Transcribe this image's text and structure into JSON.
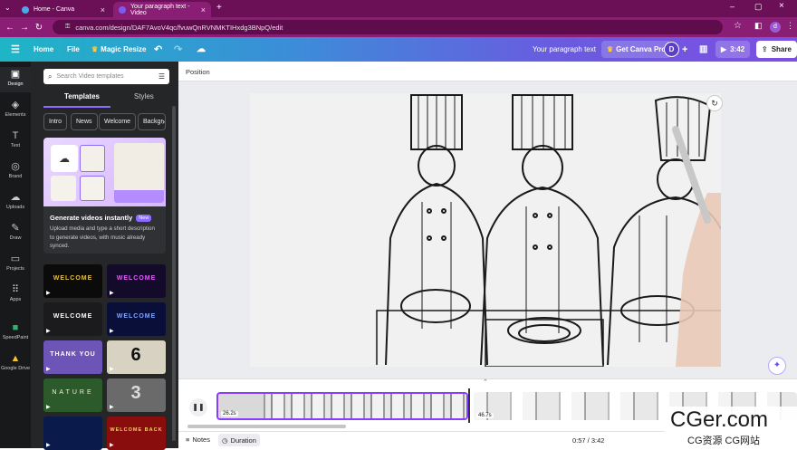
{
  "browser": {
    "tabs": [
      {
        "title": "Home - Canva",
        "active": false
      },
      {
        "title": "Your paragraph text - Video",
        "active": true
      }
    ],
    "new_tab": "+",
    "url": "canva.com/design/DAF7AvoV4qc/fvuwQnRVNMKTIHxdg3BNpQ/edit"
  },
  "topbar": {
    "menu_icon": "☰",
    "home": "Home",
    "file": "File",
    "magic_resize": "Magic Resize",
    "doc_title": "Your paragraph text",
    "get_pro": "Get Canva Pro",
    "avatar": "D",
    "plus": "+",
    "play_time": "3:42",
    "share": "Share"
  },
  "rail": [
    {
      "label": "Design",
      "icon": "▣"
    },
    {
      "label": "Elements",
      "icon": "◈"
    },
    {
      "label": "Text",
      "icon": "T"
    },
    {
      "label": "Brand",
      "icon": "◎"
    },
    {
      "label": "Uploads",
      "icon": "☁"
    },
    {
      "label": "Draw",
      "icon": "✎"
    },
    {
      "label": "Projects",
      "icon": "▭"
    },
    {
      "label": "Apps",
      "icon": "⠿"
    },
    {
      "label": "SpeedPaint",
      "icon": "■"
    },
    {
      "label": "Google Drive",
      "icon": "▲"
    }
  ],
  "panel": {
    "search_placeholder": "Search Video templates",
    "tabs": [
      "Templates",
      "Styles"
    ],
    "chips": [
      "Intro",
      "News",
      "Welcome",
      "Backgr"
    ],
    "promo": {
      "title": "Generate videos instantly",
      "badge": "New",
      "text": "Upload media and type a short description to generate videos, with music already synced."
    },
    "thumbs": [
      {
        "label": "WELCOME",
        "bg": "#0b0b0b",
        "fg": "#e7c23a"
      },
      {
        "label": "WELCOME",
        "bg": "#140a2a",
        "fg": "#e65cff"
      },
      {
        "label": "WELCOME",
        "bg": "#1b1b1d",
        "fg": "#ffffff"
      },
      {
        "label": "WELCOME",
        "bg": "#0a0f3a",
        "fg": "#7ea6ff"
      },
      {
        "label": "THANK YOU",
        "bg": "#6d55b8",
        "fg": "#ffffff"
      },
      {
        "label": "6",
        "bg": "#d8d2c2",
        "fg": "#111111"
      },
      {
        "label": "NATURE",
        "bg": "#2c5a2a",
        "fg": "#e9f3e0"
      },
      {
        "label": "3",
        "bg": "#6a6a6a",
        "fg": "#dcdcdc"
      },
      {
        "label": "",
        "bg": "#0a1a4a",
        "fg": "#ffffff"
      },
      {
        "label": "WELCOME BACK",
        "bg": "#8a0d0d",
        "fg": "#f3d06a"
      }
    ]
  },
  "editor": {
    "position_label": "Position"
  },
  "timeline": {
    "clip1_duration": "26.2s",
    "clip2_duration": "46.7s"
  },
  "bottom": {
    "notes": "Notes",
    "duration": "Duration",
    "time": "0:57 / 3:42"
  },
  "watermark": {
    "main": "CGer.com",
    "sub": "CG资源 CG网站"
  },
  "colors": {
    "browser_bg": "#6b0f57",
    "accent": "#7b4fe0",
    "clip_border": "#8b3dff"
  }
}
